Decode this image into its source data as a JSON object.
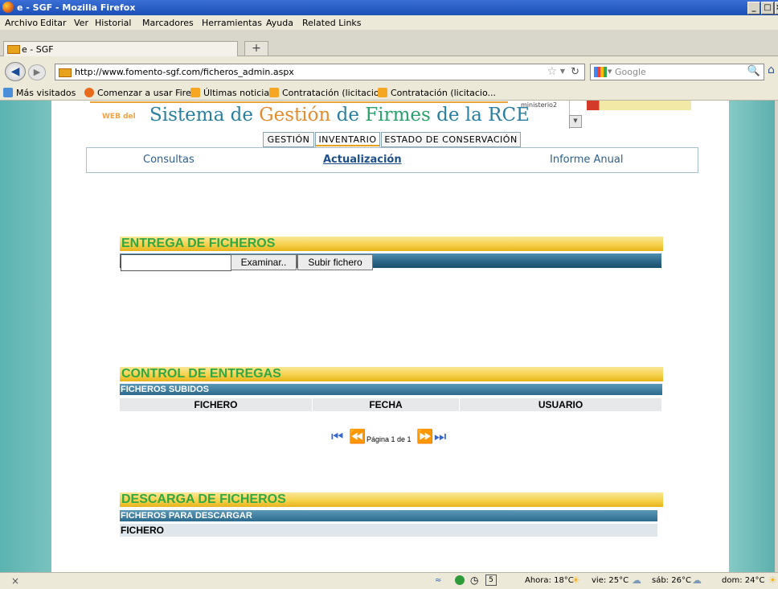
{
  "window": {
    "title": "e - SGF - Mozilla Firefox",
    "min": "_",
    "max": "□",
    "close": "×"
  },
  "menu": [
    "Archivo",
    "Editar",
    "Ver",
    "Historial",
    "Marcadores",
    "Herramientas",
    "Ayuda",
    "Related Links"
  ],
  "tab": {
    "label": "e - SGF",
    "new_tab": "+"
  },
  "nav": {
    "url": "http://www.fomento-sgf.com/ficheros_admin.aspx",
    "search_placeholder": "Google"
  },
  "bookmarks": [
    "Más visitados",
    "Comenzar a usar Fire...",
    "Últimas noticias",
    "Contratación (licitacio...",
    "Contratación (licitacio..."
  ],
  "banner": {
    "web_del": "WEB del",
    "title_a": "Sistema de ",
    "title_b": "Gestión",
    "title_c": " de ",
    "title_d": "Firmes",
    "title_e": " de la RCE",
    "user": "ministerio2"
  },
  "main_tabs": [
    "GESTIÓN",
    "INVENTARIO",
    "ESTADO DE CONSERVACIÓN"
  ],
  "main_tabs_active": "INVENTARIO",
  "subnav": [
    "Consultas",
    "Actualización",
    "Informe Anual"
  ],
  "upload": {
    "heading": "ENTREGA DE FICHEROS",
    "file_value": "",
    "browse": "Examinar..",
    "submit": "Subir fichero"
  },
  "control": {
    "heading": "CONTROL DE ENTREGAS",
    "subheading": "FICHEROS SUBIDOS",
    "columns": [
      "FICHERO",
      "FECHA",
      "USUARIO"
    ],
    "pager": "Página 1 de 1",
    "current_page": 1,
    "total_pages": 1
  },
  "download": {
    "heading": "DESCARGA DE FICHEROS",
    "subheading": "FICHEROS PARA DESCARGAR",
    "column": "FICHERO"
  },
  "status": {
    "close": "×",
    "now": "Ahora: 18°C",
    "fri": "vie: 25°C",
    "sat": "sáb: 26°C",
    "sun": "dom: 24°C",
    "date_num": "5"
  },
  "colors": {
    "accent_yellow": "#f4cf45",
    "section_text": "#31a843",
    "bar_blue": "#2c6688"
  }
}
